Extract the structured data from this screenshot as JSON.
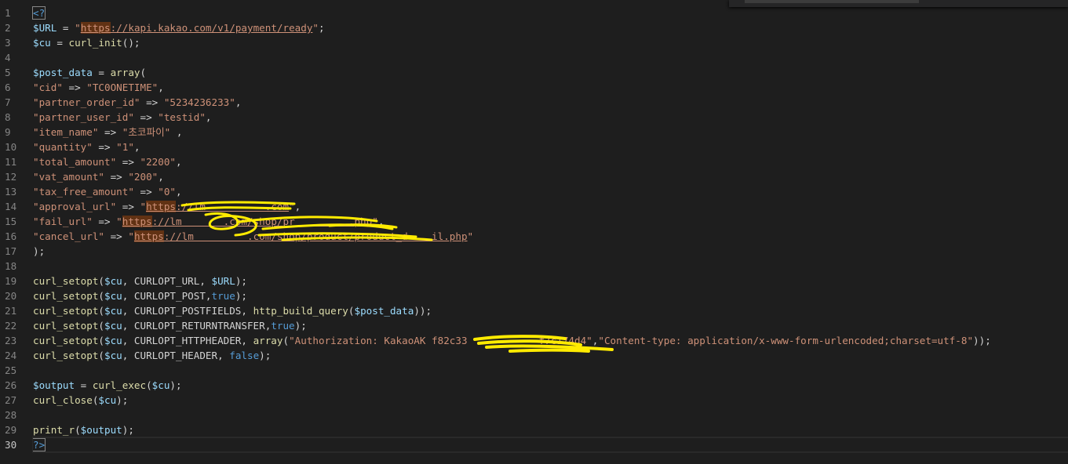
{
  "gutter": {
    "line_numbers": [
      "1",
      "2",
      "3",
      "4",
      "5",
      "6",
      "7",
      "8",
      "9",
      "10",
      "11",
      "12",
      "13",
      "14",
      "15",
      "16",
      "17",
      "18",
      "19",
      "20",
      "21",
      "22",
      "23",
      "24",
      "25",
      "26",
      "27",
      "28",
      "29",
      "30"
    ]
  },
  "code": {
    "l1": "<?",
    "l2": {
      "var": "$URL",
      "op": " = ",
      "q1": "\"",
      "https": "https",
      "rest": "://kapi.kakao.com/v1/payment/ready",
      "q2": "\"",
      "end": ";"
    },
    "l3": {
      "var": "$cu",
      "op": " = ",
      "fn": "curl_init",
      "end": "();"
    },
    "l5": {
      "var": "$post_data",
      "op": " = ",
      "fn": "array",
      "end": "("
    },
    "l6": {
      "key": "\"cid\"",
      "arrow": " => ",
      "val": "\"TC0ONETIME\"",
      "end": ","
    },
    "l7": {
      "key": "\"partner_order_id\"",
      "arrow": " => ",
      "val": "\"5234236233\"",
      "end": ","
    },
    "l8": {
      "key": "\"partner_user_id\"",
      "arrow": " => ",
      "val": "\"testid\"",
      "end": ","
    },
    "l9": {
      "key": "\"item_name\"",
      "arrow": " => ",
      "val": "\"초코파이\"",
      "end": " ,"
    },
    "l10": {
      "key": "\"quantity\"",
      "arrow": " => ",
      "val": "\"1\"",
      "end": ","
    },
    "l11": {
      "key": "\"total_amount\"",
      "arrow": " => ",
      "val": "\"2200\"",
      "end": ","
    },
    "l12": {
      "key": "\"vat_amount\"",
      "arrow": " => ",
      "val": "\"200\"",
      "end": ","
    },
    "l13": {
      "key": "\"tax_free_amount\"",
      "arrow": " => ",
      "val": "\"0\"",
      "end": ","
    },
    "l14": {
      "key": "\"approval_url\"",
      "arrow": " => ",
      "q1": "\"",
      "https": "https",
      "rest": "://lm          .com",
      "q2": "\"",
      "end": ","
    },
    "l15": {
      "key": "\"fail_url\"",
      "arrow": " => ",
      "q1": "\"",
      "https": "https",
      "rest": "://lm       .com/shop/pr         .php",
      "q2": "\"",
      "end": ","
    },
    "l16": {
      "key": "\"cancel_url\"",
      "arrow": " => ",
      "q1": "\"",
      "https": "https",
      "rest": "://lm         .com/shop/product/product_d    il.php",
      "q2": "\"",
      "end": ""
    },
    "l17": ");",
    "l19": {
      "fn": "curl_setopt",
      "p1": "(",
      "v1": "$cu",
      "mid": ", CURLOPT_URL, ",
      "v2": "$URL",
      "end": ");"
    },
    "l20": {
      "fn": "curl_setopt",
      "p1": "(",
      "v1": "$cu",
      "mid": ", CURLOPT_POST,",
      "kw": "true",
      "end": ");"
    },
    "l21": {
      "fn": "curl_setopt",
      "p1": "(",
      "v1": "$cu",
      "mid": ", CURLOPT_POSTFIELDS, ",
      "fn2": "http_build_query",
      "p2": "(",
      "v2": "$post_data",
      "end": "));"
    },
    "l22": {
      "fn": "curl_setopt",
      "p1": "(",
      "v1": "$cu",
      "mid": ", CURLOPT_RETURNTRANSFER,",
      "kw": "true",
      "end": ");"
    },
    "l23": {
      "fn": "curl_setopt",
      "p1": "(",
      "v1": "$cu",
      "mid": ", CURLOPT_HTTPHEADER, ",
      "fn2": "array",
      "p2": "(",
      "s1": "\"Authorization: KakaoAK f82c33            f7c174d4\"",
      "comma": ",",
      "s2": "\"Content-type: application/x-www-form-urlencoded;charset=utf-8\"",
      "end": "));"
    },
    "l24": {
      "fn": "curl_setopt",
      "p1": "(",
      "v1": "$cu",
      "mid": ", CURLOPT_HEADER, ",
      "kw": "false",
      "end": ");"
    },
    "l26": {
      "var": "$output",
      "op": " = ",
      "fn": "curl_exec",
      "p1": "(",
      "v1": "$cu",
      "end": ");"
    },
    "l27": {
      "fn": "curl_close",
      "p1": "(",
      "v1": "$cu",
      "end": ");"
    },
    "l29": {
      "fn": "print_r",
      "p1": "(",
      "v1": "$output",
      "end": ");"
    },
    "l30": "?>"
  },
  "colors": {
    "background": "#1e1e1e",
    "variable": "#9cdcfe",
    "string": "#ce9178",
    "function": "#dcdcaa",
    "keyword": "#569cd6",
    "redaction": "#ffeb00"
  }
}
